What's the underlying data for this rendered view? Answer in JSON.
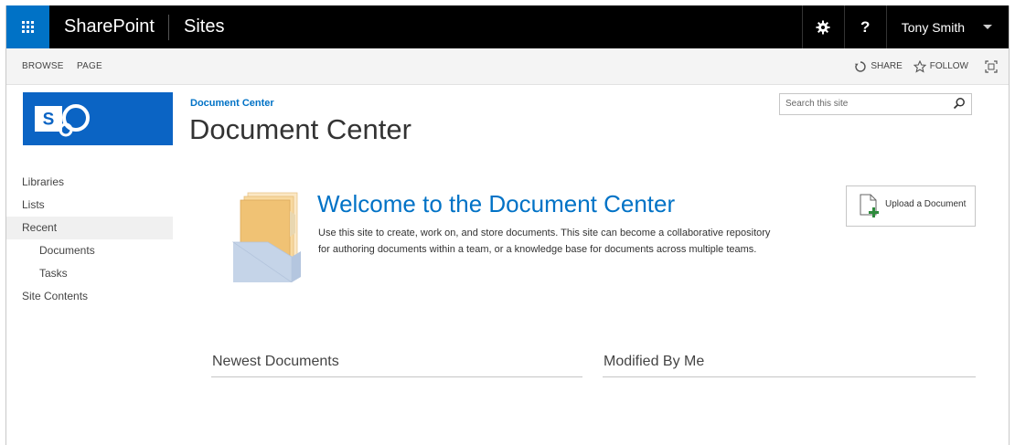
{
  "suite_bar": {
    "brand": "SharePoint",
    "sites_link": "Sites",
    "help": "?",
    "user_name": "Tony Smith"
  },
  "ribbon": {
    "tabs": [
      "BROWSE",
      "PAGE"
    ],
    "share_label": "SHARE",
    "follow_label": "FOLLOW"
  },
  "left_nav": {
    "items": [
      {
        "label": "Libraries"
      },
      {
        "label": "Lists"
      },
      {
        "label": "Recent"
      },
      {
        "label": "Documents"
      },
      {
        "label": "Tasks"
      },
      {
        "label": "Site Contents"
      }
    ]
  },
  "main": {
    "breadcrumb": "Document Center",
    "title": "Document Center",
    "search_placeholder": "Search this site",
    "welcome_heading": "Welcome to the Document Center",
    "welcome_text_line1": "Use this site to create, work on, and store documents. This site can become a collaborative repository",
    "welcome_text_line2": "for authoring documents within a team, or a knowledge base for documents across multiple teams.",
    "upload_button": "Upload a Document",
    "sections": [
      "Newest Documents",
      "Modified By Me"
    ]
  },
  "colors": {
    "suite_bar": "#000000",
    "waffle": "#0072c6",
    "accent": "#0072c6",
    "logo": "#0b64c4",
    "folder_front": "#c5d4e8",
    "folder_papers": "#f0c274"
  }
}
